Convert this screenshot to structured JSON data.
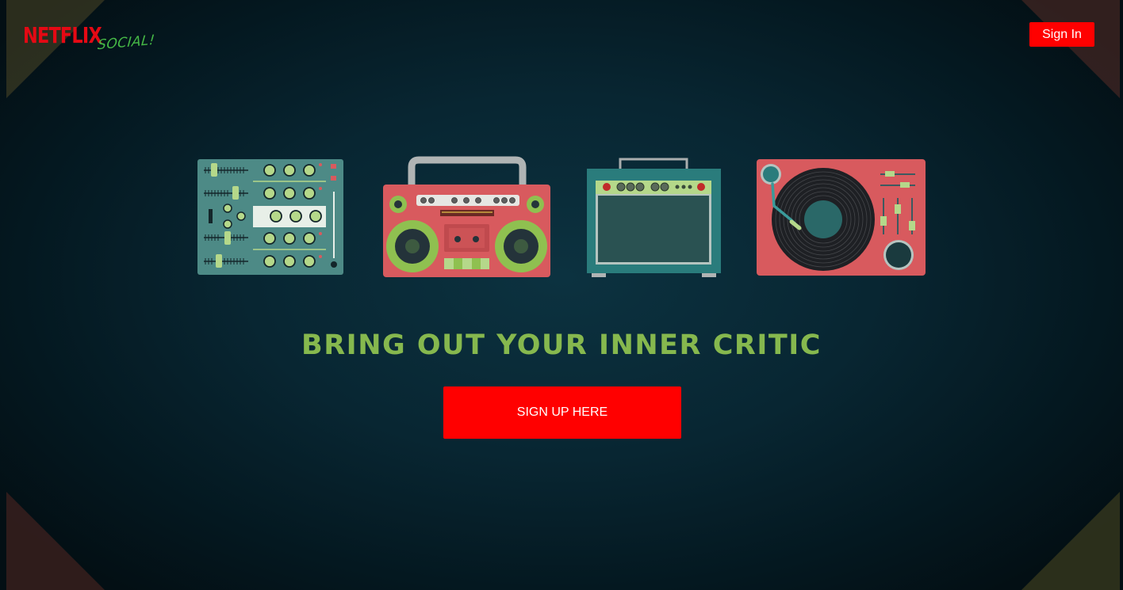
{
  "header": {
    "logo_main": "NETFLIX",
    "logo_sub": "SOCIAL!",
    "signin_label": "Sign In"
  },
  "hero": {
    "headline": "BRING OUT YOUR INNER CRITIC",
    "signup_label": "SIGN UP HERE"
  },
  "illustrations": [
    {
      "name": "mixer-console-icon"
    },
    {
      "name": "boombox-icon"
    },
    {
      "name": "guitar-amp-icon"
    },
    {
      "name": "turntable-icon"
    }
  ],
  "colors": {
    "brand_red": "#e50914",
    "button_red": "#ff0000",
    "accent_green": "#86b84e",
    "logo_green": "#46b946",
    "teal": "#2a7c7c",
    "coral": "#d85a5e"
  }
}
